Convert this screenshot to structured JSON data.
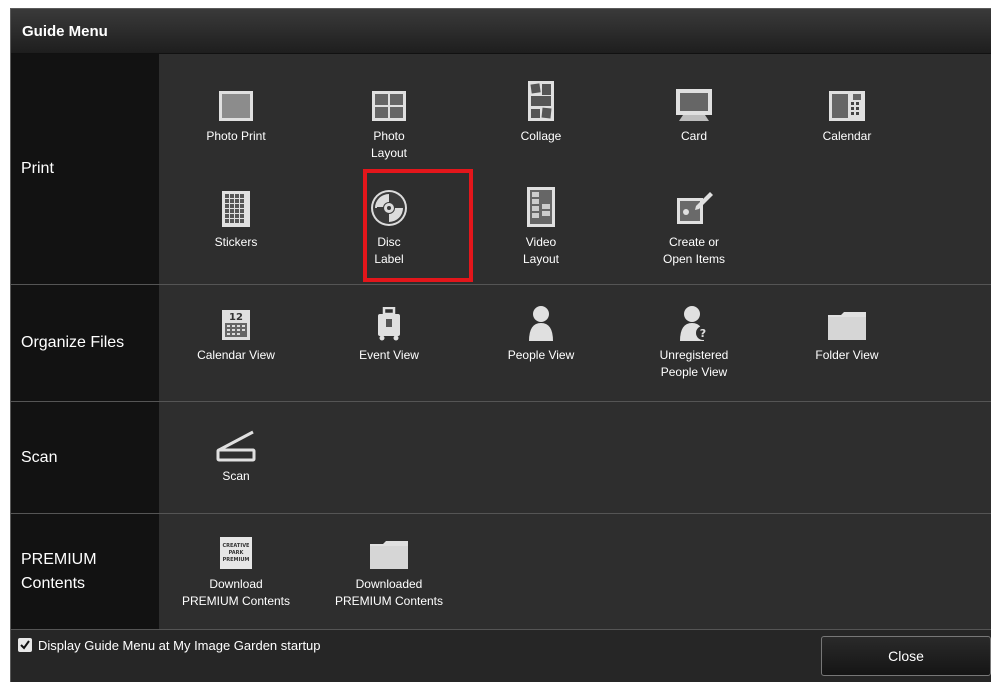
{
  "window": {
    "title": "Guide Menu"
  },
  "sections": {
    "print": {
      "label": "Print",
      "items": [
        {
          "label": "Photo Print",
          "icon": "photo-print-icon"
        },
        {
          "label": "Photo\nLayout",
          "icon": "photo-layout-icon"
        },
        {
          "label": "Collage",
          "icon": "collage-icon"
        },
        {
          "label": "Card",
          "icon": "card-icon"
        },
        {
          "label": "Calendar",
          "icon": "calendar-icon"
        },
        {
          "label": "Stickers",
          "icon": "stickers-icon"
        },
        {
          "label": "Disc\nLabel",
          "icon": "disc-label-icon",
          "highlighted": true
        },
        {
          "label": "Video\nLayout",
          "icon": "video-layout-icon"
        },
        {
          "label": "Create or\nOpen Items",
          "icon": "create-open-items-icon"
        }
      ]
    },
    "organize": {
      "label": "Organize Files",
      "items": [
        {
          "label": "Calendar View",
          "icon": "calendar-view-icon",
          "icon_text": "12"
        },
        {
          "label": "Event View",
          "icon": "event-view-icon"
        },
        {
          "label": "People View",
          "icon": "people-view-icon"
        },
        {
          "label": "Unregistered\nPeople View",
          "icon": "unregistered-people-view-icon"
        },
        {
          "label": "Folder View",
          "icon": "folder-view-icon"
        }
      ]
    },
    "scan": {
      "label": "Scan",
      "items": [
        {
          "label": "Scan",
          "icon": "scan-icon"
        }
      ]
    },
    "premium": {
      "label": "PREMIUM\nContents",
      "items": [
        {
          "label": "Download\nPREMIUM Contents",
          "icon": "download-premium-icon",
          "icon_text": "CREATIVE\nPARK\nPREMIUM"
        },
        {
          "label": "Downloaded\nPREMIUM Contents",
          "icon": "downloaded-premium-icon"
        }
      ]
    }
  },
  "footer": {
    "checkbox_label": "Display Guide Menu at My Image Garden startup",
    "checkbox_checked": true,
    "close_label": "Close"
  },
  "colors": {
    "highlight": "#e3161b",
    "background": "#2b2b2b",
    "label_column": "#121212"
  }
}
